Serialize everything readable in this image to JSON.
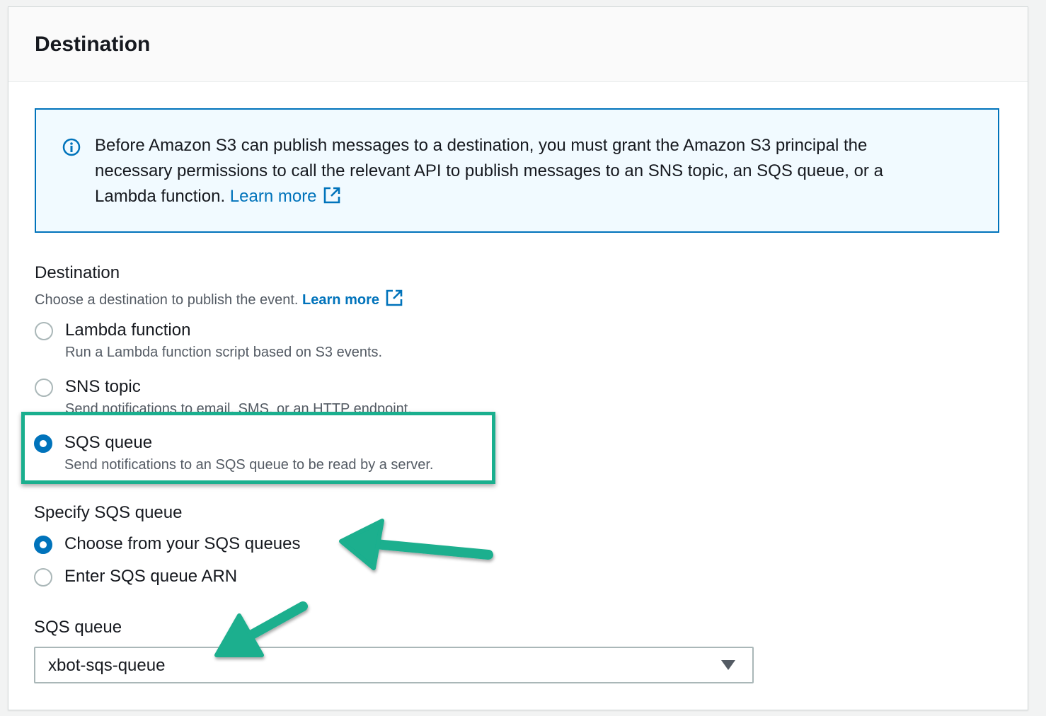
{
  "panel": {
    "title": "Destination"
  },
  "info_alert": {
    "icon": "info-icon",
    "text": "Before Amazon S3 can publish messages to a destination, you must grant the Amazon S3 principal the necessary permissions to call the relevant API to publish messages to an SNS topic, an SQS queue, or a Lambda function.",
    "link_label": "Learn more",
    "link_icon": "external-link-icon"
  },
  "destination": {
    "label": "Destination",
    "description": "Choose a destination to publish the event.",
    "link_label": "Learn more",
    "link_icon": "external-link-icon",
    "options": [
      {
        "label": "Lambda function",
        "description": "Run a Lambda function script based on S3 events.",
        "checked": false
      },
      {
        "label": "SNS topic",
        "description": "Send notifications to email, SMS, or an HTTP endpoint.",
        "checked": false
      },
      {
        "label": "SQS queue",
        "description": "Send notifications to an SQS queue to be read by a server.",
        "checked": true
      }
    ]
  },
  "specify_queue": {
    "label": "Specify SQS queue",
    "options": [
      {
        "label": "Choose from your SQS queues",
        "checked": true
      },
      {
        "label": "Enter SQS queue ARN",
        "checked": false
      }
    ]
  },
  "sqs_queue": {
    "label": "SQS queue",
    "selected_value": "xbot-sqs-queue",
    "dropdown_icon": "caret-down-icon"
  },
  "colors": {
    "accent": "#0073bb",
    "annotation": "#1aaf8e",
    "info_background": "#f1faff"
  }
}
